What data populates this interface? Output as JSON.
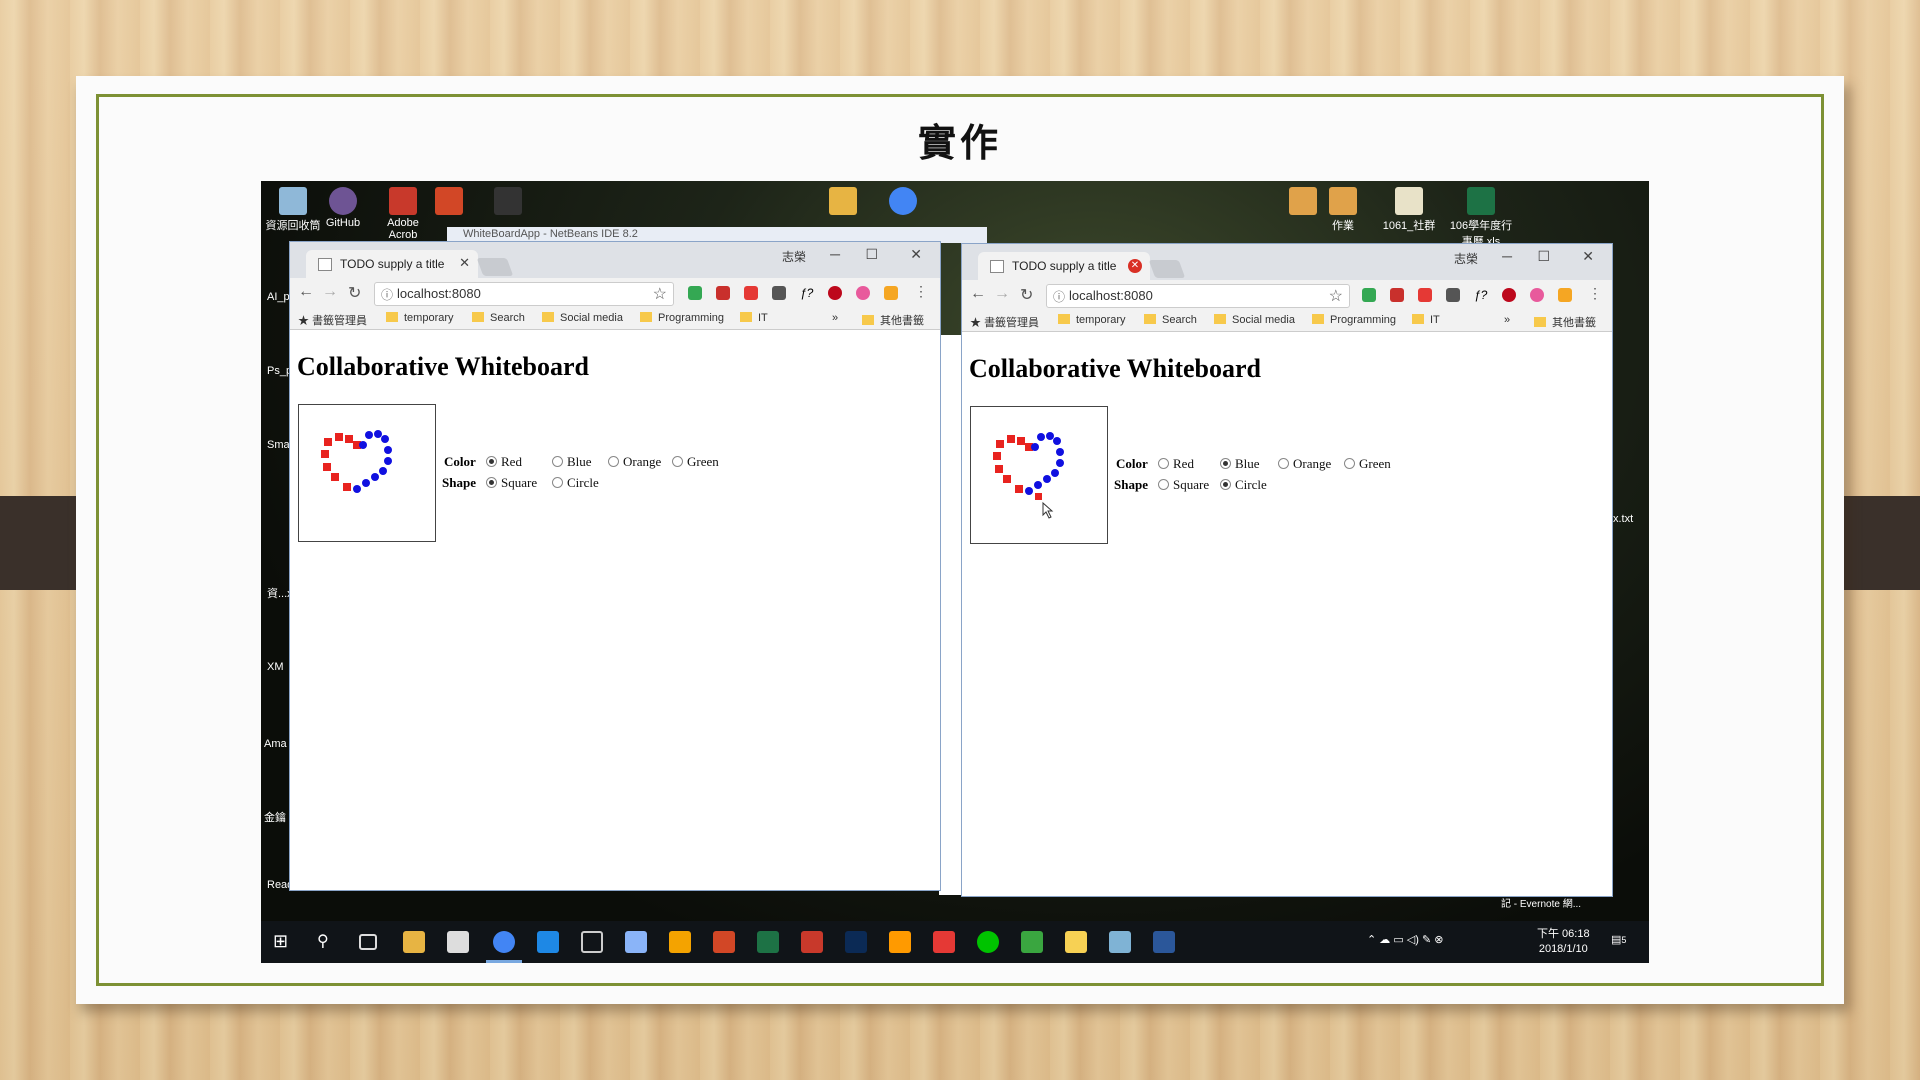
{
  "slide": {
    "title": "實作"
  },
  "desktop": {
    "icons": [
      {
        "label": "資源回收筒",
        "color": "#8fb8d8"
      },
      {
        "label": "GitHub",
        "color": "#6e5494"
      },
      {
        "label": "Adobe Acrob",
        "color": "#c8392b"
      },
      {
        "label": "",
        "color": "#d24726"
      },
      {
        "label": "",
        "color": "#333333"
      },
      {
        "label": "",
        "color": "#e7b443"
      },
      {
        "label": "",
        "color": "#4285f4"
      },
      {
        "label": "",
        "color": "#e0a24a"
      },
      {
        "label": "作業",
        "color": "#e0a24a"
      },
      {
        "label": "1061_社群",
        "color": "#e8e2c8"
      },
      {
        "label": "106學年度行事曆.xls",
        "color": "#1d7245"
      }
    ],
    "left_labels": [
      "AI_p",
      "Ps_p",
      "Sma",
      "資...xr",
      "XM",
      "Ama 人 Je",
      "金鑰 秘密",
      "Read"
    ],
    "right_labels": [
      "x.txt",
      "記 - Evernote 網..."
    ],
    "ide_title": "WhiteBoardApp - NetBeans IDE 8.2"
  },
  "browser_left": {
    "tab_title": "TODO supply a title",
    "user": "志榮",
    "url": "localhost:8080",
    "bookmarks": [
      "書籤管理員",
      "temporary",
      "Search",
      "Social media",
      "Programming",
      "IT",
      "»",
      "其他書籤"
    ],
    "heading": "Collaborative Whiteboard",
    "color_label": "Color",
    "shape_label": "Shape",
    "colors": [
      "Red",
      "Blue",
      "Orange",
      "Green"
    ],
    "shapes": [
      "Square",
      "Circle"
    ],
    "selected_color": "Red",
    "selected_shape": "Square"
  },
  "browser_right": {
    "tab_title": "TODO supply a title",
    "user": "志榮",
    "url": "localhost:8080",
    "bookmarks": [
      "書籤管理員",
      "temporary",
      "Search",
      "Social media",
      "Programming",
      "IT",
      "»",
      "其他書籤"
    ],
    "heading": "Collaborative Whiteboard",
    "color_label": "Color",
    "shape_label": "Shape",
    "colors": [
      "Red",
      "Blue",
      "Orange",
      "Green"
    ],
    "shapes": [
      "Square",
      "Circle"
    ],
    "selected_color": "Blue",
    "selected_shape": "Circle"
  },
  "taskbar": {
    "time": "下午 06:18",
    "date": "2018/1/10",
    "notifications": "5"
  },
  "colors": {
    "red": "#e8231f",
    "blue": "#1010e0",
    "frame": "#7d9134"
  }
}
